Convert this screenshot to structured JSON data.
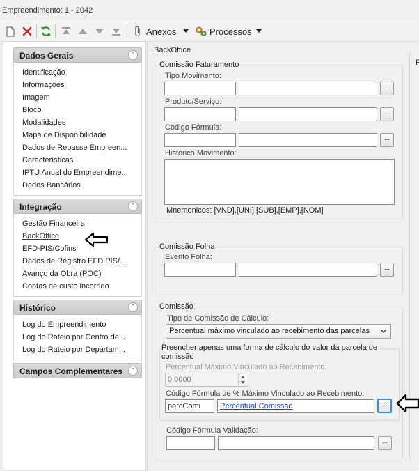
{
  "window": {
    "title": "Empreendimento: 1 - 2042"
  },
  "toolbar": {
    "anexos_label": "Anexos",
    "processos_label": "Processos"
  },
  "sidebar": {
    "sections": [
      {
        "title": "Dados Gerais",
        "items": [
          "Identificação",
          "Informações",
          "Imagem",
          "Bloco",
          "Modalidades",
          "Mapa de Disponibilidade",
          "Dados de Repasse Empreen...",
          "Características",
          "IPTU Anual do Empreendime...",
          "Dados Bancários"
        ]
      },
      {
        "title": "Integração",
        "items": [
          "Gestão Financeira",
          "BackOffice",
          "EFD-PIS/Cofins",
          "Dados de Registro EFD PIS/...",
          "Avanço da Obra (POC)",
          "Contas de custo incorrido"
        ]
      },
      {
        "title": "Histórico",
        "items": [
          "Log do Empreendimento",
          "Log do Rateio por Centro de...",
          "Log do Rateio por Departam..."
        ]
      },
      {
        "title": "Campos Complementares",
        "items": []
      }
    ]
  },
  "main": {
    "section_title": "BackOffice",
    "right_clip_letter": "F",
    "comissao_faturamento": {
      "title": "Comissão Faturamento",
      "tipo_movimento_label": "Tipo Movimento:",
      "produto_servico_label": "Produto/Serviço:",
      "codigo_formula_label": "Código Fórmula:",
      "historico_movimento_label": "Histórico Movimento:",
      "mnemonicos": "Mnemonicos: [VND],[UNI],[SUB],[EMP],[NOM]"
    },
    "comissao_folha": {
      "title": "Comissão Folha",
      "evento_folha_label": "Evento Folha:"
    },
    "comissao": {
      "title": "Comissão",
      "tipo_calculo_label": "Tipo de Comissão de Cálculo:",
      "tipo_calculo_value": "Percentual máximo vinculado ao recebimento das parcelas",
      "preencher_title": "Preencher apenas uma forma de cálculo do valor da parcela de comissão",
      "percentual_maximo_label": "Percentual Máximo Vinculado ao Recebimento:",
      "percentual_maximo_value": "0,0000",
      "codigo_formula_pct_label": "Código Fórmula de % Máximo Vinculado ao Recebimento:",
      "codigo_formula_pct_code": "percComi",
      "codigo_formula_pct_desc": "Percentual Comissão",
      "codigo_formula_validacao_label": "Código Fórmula Validação:"
    },
    "ellipsis": "..."
  }
}
